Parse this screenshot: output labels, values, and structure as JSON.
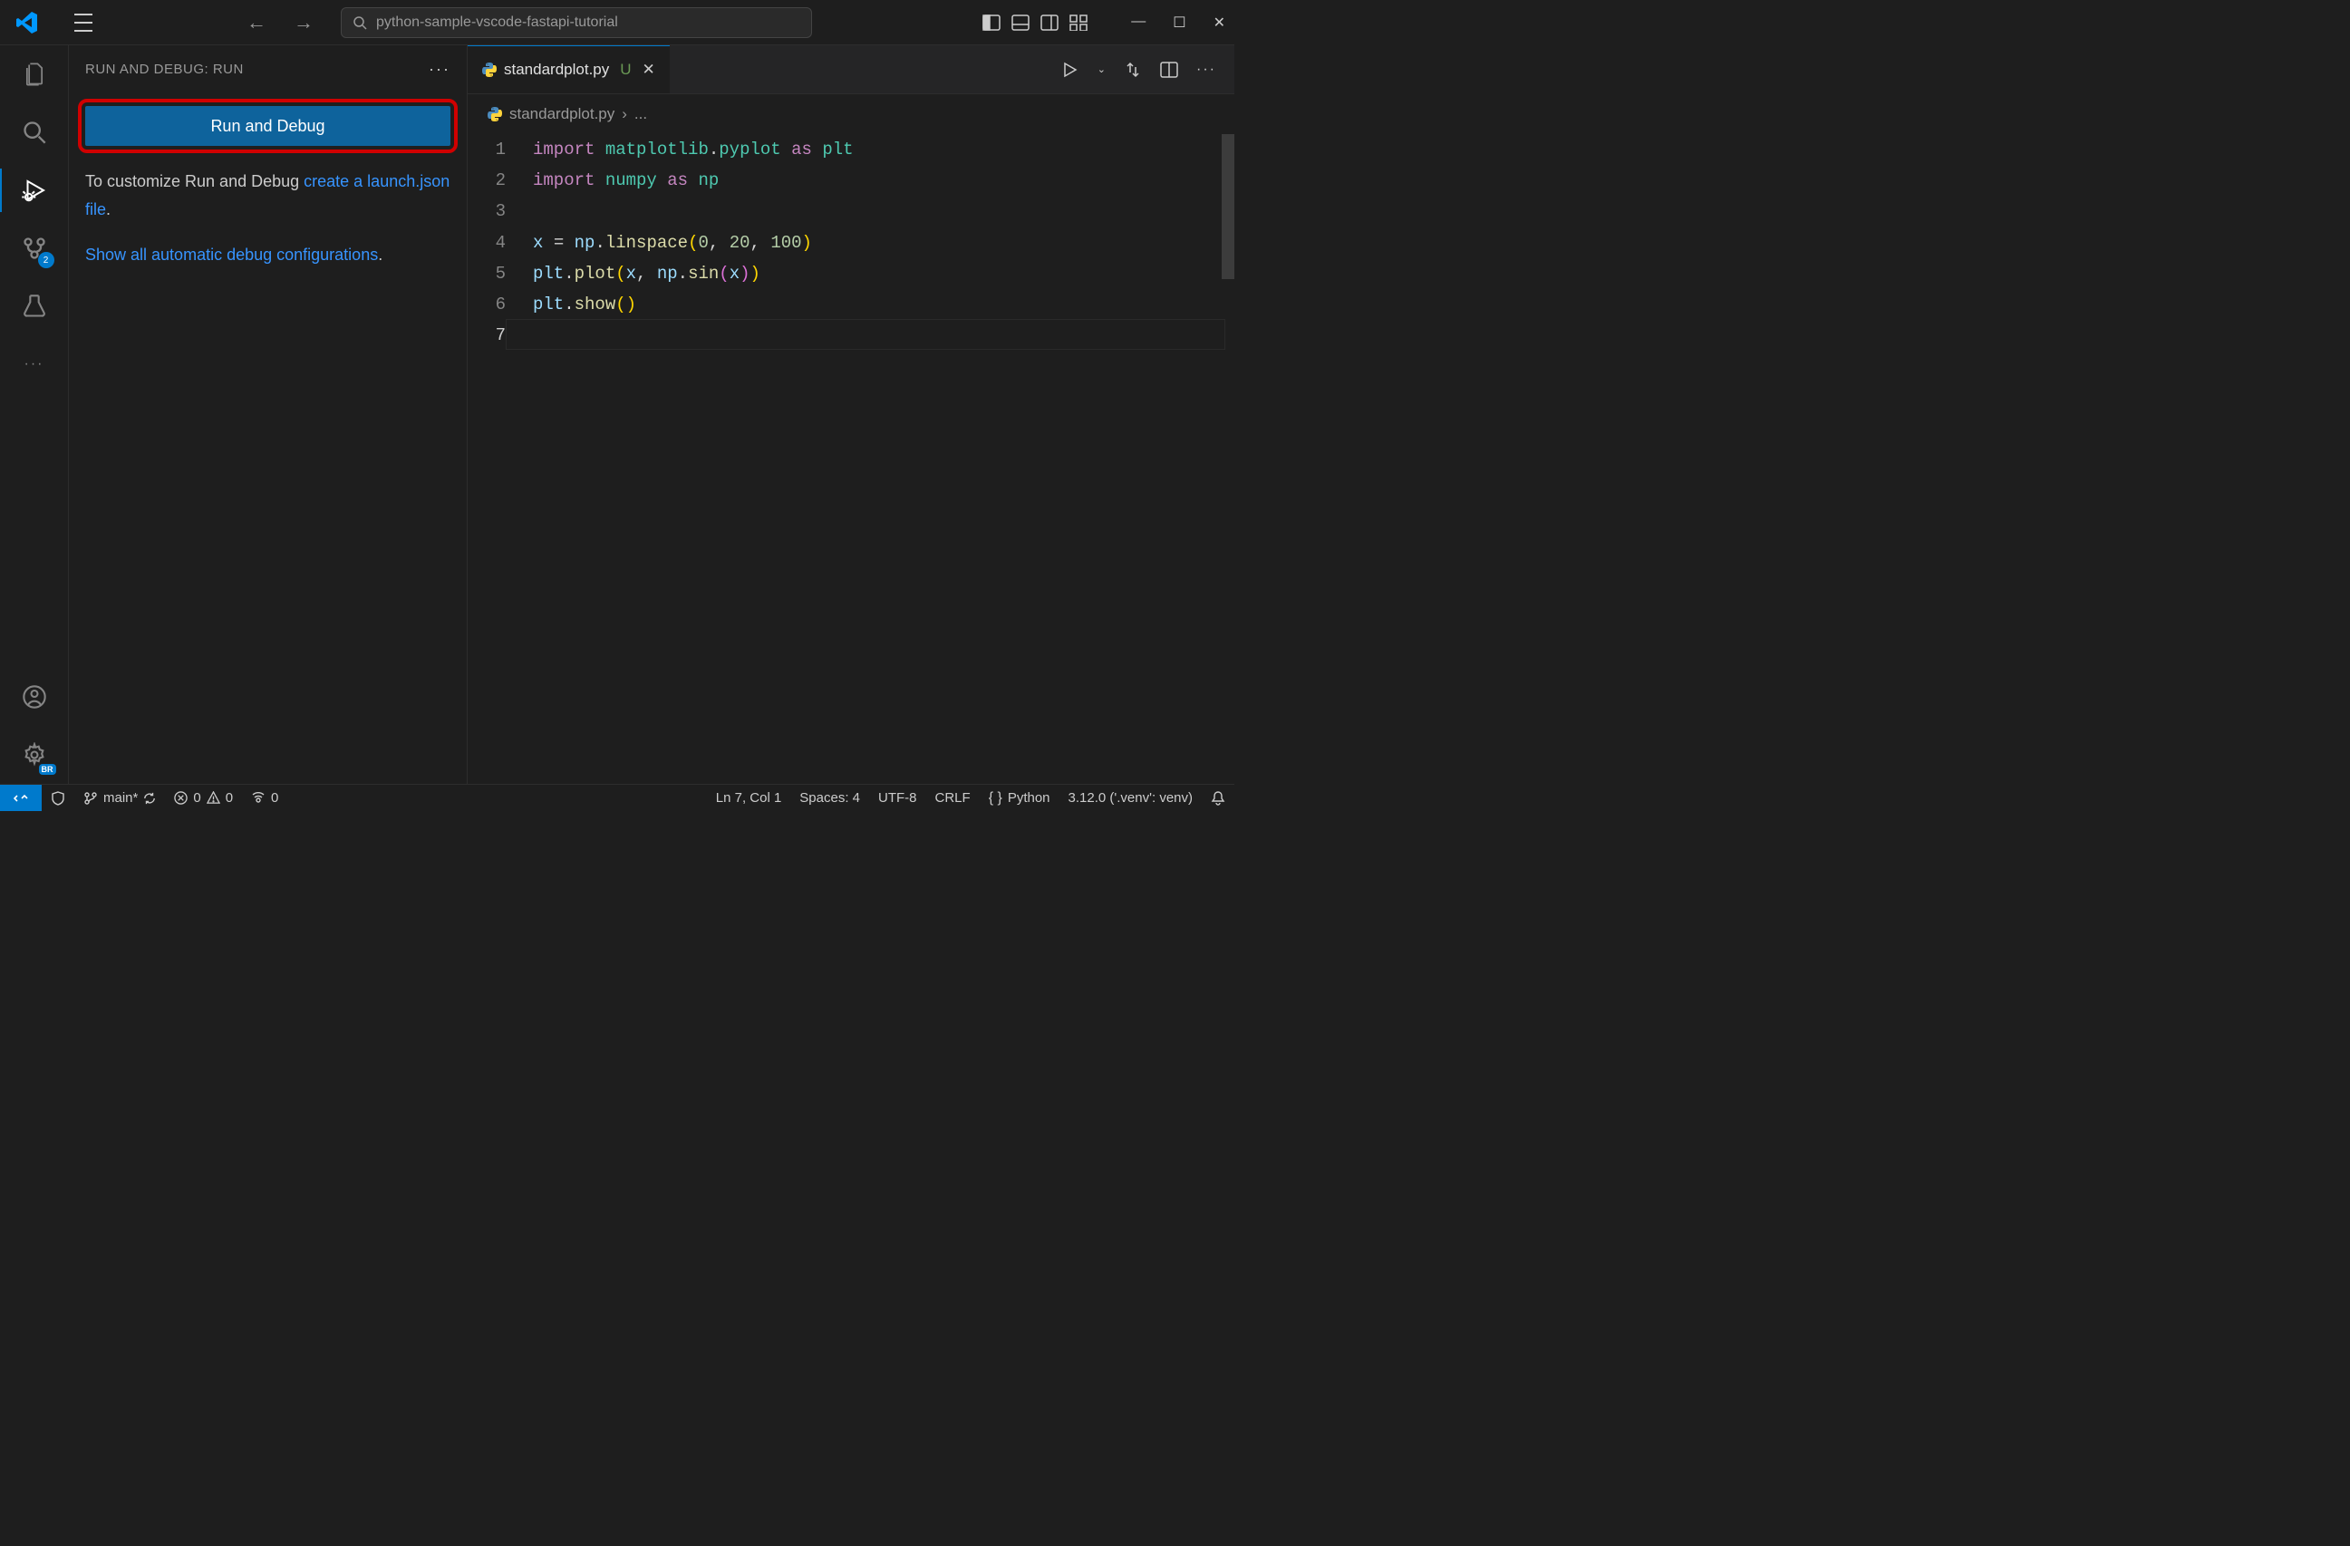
{
  "titlebar": {
    "search_text": "python-sample-vscode-fastapi-tutorial"
  },
  "sidepanel": {
    "header": "RUN AND DEBUG: RUN",
    "button_label": "Run and Debug",
    "customize_text": "To customize Run and Debug ",
    "create_link": "create a launch.json file",
    "show_all_link": "Show all automatic debug configurations",
    "period": "."
  },
  "tab": {
    "filename": "standardplot.py",
    "modified": "U"
  },
  "breadcrumb": {
    "file": "standardplot.py",
    "sep": "›",
    "rest": "..."
  },
  "code": {
    "lines": [
      1,
      2,
      3,
      4,
      5,
      6,
      7
    ],
    "l1_kw": "import",
    "l1_mod": "matplotlib",
    "l1_sub": "pyplot",
    "l1_as": "as",
    "l1_alias": "plt",
    "l2_kw": "import",
    "l2_mod": "numpy",
    "l2_as": "as",
    "l2_alias": "np",
    "l4_var": "x",
    "l4_eq": "=",
    "l4_np": "np",
    "l4_fn": "linspace",
    "l4_a": "0",
    "l4_b": "20",
    "l4_c": "100",
    "l5_plt": "plt",
    "l5_fn": "plot",
    "l5_x": "x",
    "l5_np": "np",
    "l5_sin": "sin",
    "l5_arg": "x",
    "l6_plt": "plt",
    "l6_fn": "show"
  },
  "scm_badge": "2",
  "settings_badge": "BR",
  "status": {
    "branch": "main*",
    "errors": "0",
    "warnings": "0",
    "ports": "0",
    "cursor": "Ln 7, Col 1",
    "spaces": "Spaces: 4",
    "encoding": "UTF-8",
    "eol": "CRLF",
    "lang": "Python",
    "python_version": "3.12.0 ('.venv': venv)"
  }
}
